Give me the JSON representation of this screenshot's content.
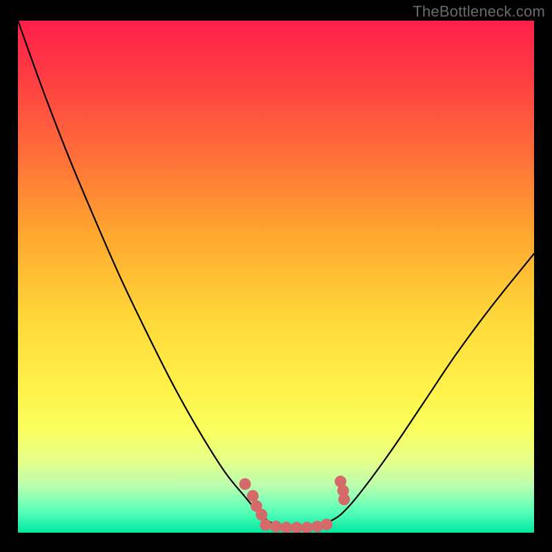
{
  "attribution": "TheBottleneck.com",
  "colors": {
    "background": "#000000",
    "gradient_top": "#ff1f4a",
    "gradient_mid": "#ffe23f",
    "gradient_bottom": "#00e8a0",
    "curve": "#000000",
    "marker": "#d46a6a",
    "attribution_text": "#6a6a6a"
  },
  "markers_left": [
    {
      "x": 0.44,
      "y": 0.905
    },
    {
      "x": 0.455,
      "y": 0.928
    },
    {
      "x": 0.462,
      "y": 0.948
    },
    {
      "x": 0.472,
      "y": 0.965
    }
  ],
  "markers_right": [
    {
      "x": 0.625,
      "y": 0.9
    },
    {
      "x": 0.63,
      "y": 0.918
    },
    {
      "x": 0.632,
      "y": 0.935
    }
  ],
  "markers_bottom": [
    {
      "x": 0.48,
      "y": 0.985
    },
    {
      "x": 0.5,
      "y": 0.988
    },
    {
      "x": 0.52,
      "y": 0.99
    },
    {
      "x": 0.54,
      "y": 0.99
    },
    {
      "x": 0.56,
      "y": 0.99
    },
    {
      "x": 0.58,
      "y": 0.988
    },
    {
      "x": 0.598,
      "y": 0.984
    }
  ],
  "chart_data": {
    "type": "line",
    "title": "",
    "xlabel": "",
    "ylabel": "",
    "xlim": [
      0,
      1
    ],
    "ylim": [
      0,
      1
    ],
    "series": [
      {
        "name": "bottleneck-curve-left",
        "x": [
          0.0,
          0.05,
          0.1,
          0.15,
          0.2,
          0.25,
          0.3,
          0.35,
          0.4,
          0.44,
          0.47,
          0.5,
          0.53
        ],
        "y": [
          0.0,
          0.14,
          0.27,
          0.39,
          0.505,
          0.61,
          0.71,
          0.8,
          0.88,
          0.93,
          0.965,
          0.985,
          0.99
        ]
      },
      {
        "name": "bottleneck-curve-right",
        "x": [
          0.53,
          0.57,
          0.61,
          0.64,
          0.68,
          0.73,
          0.79,
          0.85,
          0.92,
          1.0
        ],
        "y": [
          0.99,
          0.988,
          0.975,
          0.95,
          0.9,
          0.83,
          0.74,
          0.65,
          0.555,
          0.455
        ]
      }
    ],
    "annotations": [
      {
        "series": "bottleneck-curve-left",
        "x": 0.44,
        "y": 0.905,
        "kind": "dot"
      },
      {
        "series": "bottleneck-curve-left",
        "x": 0.455,
        "y": 0.928,
        "kind": "dot"
      },
      {
        "series": "bottleneck-curve-left",
        "x": 0.462,
        "y": 0.948,
        "kind": "dot"
      },
      {
        "series": "bottleneck-curve-left",
        "x": 0.472,
        "y": 0.965,
        "kind": "dot"
      },
      {
        "series": "bottleneck-curve-right",
        "x": 0.625,
        "y": 0.9,
        "kind": "dot"
      },
      {
        "series": "bottleneck-curve-right",
        "x": 0.63,
        "y": 0.918,
        "kind": "dot"
      },
      {
        "series": "bottleneck-curve-right",
        "x": 0.632,
        "y": 0.935,
        "kind": "dot"
      },
      {
        "series": "trough",
        "x": 0.48,
        "y": 0.985,
        "kind": "dot"
      },
      {
        "series": "trough",
        "x": 0.5,
        "y": 0.988,
        "kind": "dot"
      },
      {
        "series": "trough",
        "x": 0.52,
        "y": 0.99,
        "kind": "dot"
      },
      {
        "series": "trough",
        "x": 0.54,
        "y": 0.99,
        "kind": "dot"
      },
      {
        "series": "trough",
        "x": 0.56,
        "y": 0.99,
        "kind": "dot"
      },
      {
        "series": "trough",
        "x": 0.58,
        "y": 0.988,
        "kind": "dot"
      },
      {
        "series": "trough",
        "x": 0.598,
        "y": 0.984,
        "kind": "dot"
      }
    ]
  }
}
